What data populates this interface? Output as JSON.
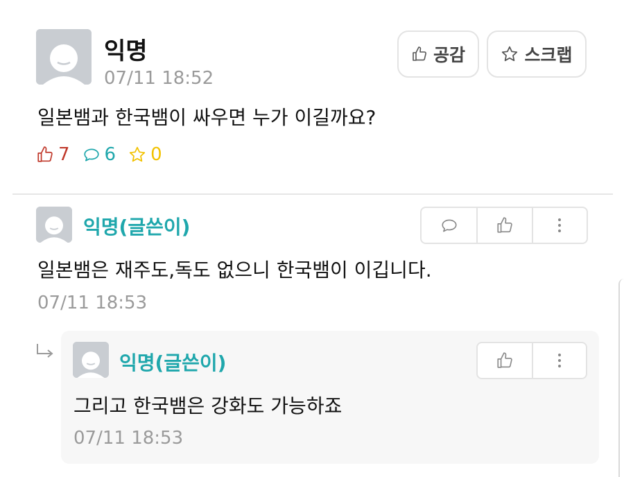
{
  "post": {
    "author": "익명",
    "time": "07/11 18:52",
    "text": "일본뱀과 한국뱀이 싸우면 누가 이길까요?",
    "like_button": "공감",
    "scrap_button": "스크랩",
    "likes": "7",
    "comments": "6",
    "scraps": "0"
  },
  "comment": {
    "author": "익명(글쓴이)",
    "text": "일본뱀은 재주도,독도 없으니 한국뱀이 이깁니다.",
    "time": "07/11 18:53"
  },
  "reply": {
    "author": "익명(글쓴이)",
    "text": "그리고 한국뱀은 강화도 가능하죠",
    "time": "07/11 18:53"
  },
  "colors": {
    "accent": "#1fa7ac",
    "like_red": "#c0392b",
    "comment_teal": "#1fa7ac",
    "scrap_yellow": "#f2c200"
  },
  "icons": [
    "thumbs-up-icon",
    "star-icon",
    "comment-icon",
    "more-vertical-icon",
    "reply-arrow-icon"
  ]
}
